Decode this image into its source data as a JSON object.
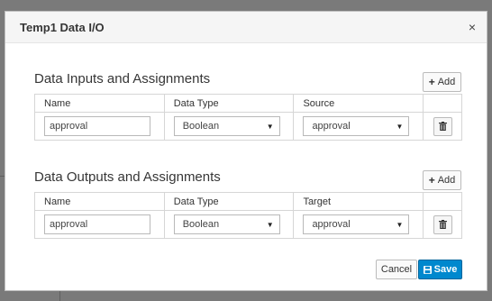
{
  "dialog": {
    "title": "Temp1 Data I/O",
    "close_glyph": "×"
  },
  "inputs": {
    "title": "Data Inputs and Assignments",
    "add_label": "Add",
    "columns": [
      "Name",
      "Data Type",
      "Source",
      ""
    ],
    "rows": [
      {
        "name": "approval",
        "data_type": "Boolean",
        "source": "approval"
      }
    ]
  },
  "outputs": {
    "title": "Data Outputs and Assignments",
    "add_label": "Add",
    "columns": [
      "Name",
      "Data Type",
      "Target",
      ""
    ],
    "rows": [
      {
        "name": "approval",
        "data_type": "Boolean",
        "target": "approval"
      }
    ]
  },
  "footer": {
    "cancel_label": "Cancel",
    "save_label": "Save"
  },
  "colors": {
    "primary": "#0088ce",
    "header_bg": "#f5f5f5"
  },
  "icons": {
    "add": "plus-icon",
    "delete": "trash-icon",
    "save": "floppy-disk-icon",
    "dropdown": "caret-down-icon",
    "close": "close-icon"
  }
}
